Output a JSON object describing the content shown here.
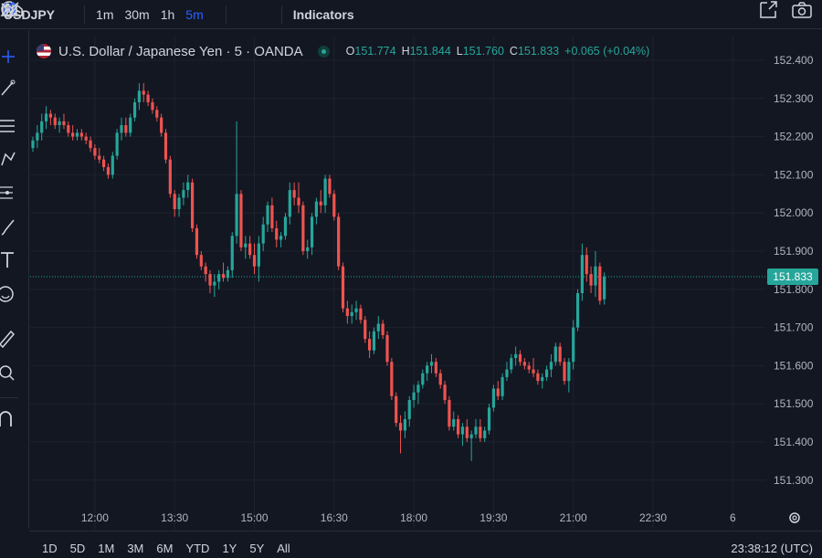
{
  "toolbar": {
    "symbol": "USDJPY",
    "intervals": [
      "1m",
      "30m",
      "1h",
      "5m"
    ],
    "active_interval": "5m",
    "indicators_label": "Indicators"
  },
  "legend": {
    "title": "U.S. Dollar / Japanese Yen · 5 · OANDA",
    "o_label": "O",
    "o": "151.774",
    "h_label": "H",
    "h": "151.844",
    "l_label": "L",
    "l": "151.760",
    "c_label": "C",
    "c": "151.833",
    "change": "+0.065 (+0.04%)"
  },
  "price_badge": "151.833",
  "ranges": [
    "1D",
    "5D",
    "1M",
    "3M",
    "6M",
    "YTD",
    "1Y",
    "5Y",
    "All"
  ],
  "clock": "23:38:12 (UTC)",
  "colors": {
    "up": "#26a69a",
    "down": "#ef5350",
    "background": "#131722",
    "grid": "#1e222d",
    "accent": "#2962ff"
  },
  "icons": [
    "plus-circle-icon",
    "bar-style-icon",
    "candles-icon",
    "area-icon",
    "chevron-down-icon",
    "indicators-icon",
    "crosshair-icon",
    "trendline-icon",
    "fib-icon",
    "pattern-icon",
    "prediction-icon",
    "brush-icon",
    "text-icon",
    "emoji-icon",
    "ruler-icon",
    "zoom-icon",
    "magnet-icon",
    "fullscreen-icon",
    "camera-icon",
    "settings-icon"
  ],
  "chart_data": {
    "type": "candlestick",
    "symbol": "USDJPY",
    "interval": "5m",
    "ylim": [
      151.25,
      152.45
    ],
    "y_ticks": [
      "152.400",
      "152.300",
      "152.200",
      "152.100",
      "152.000",
      "151.900",
      "151.800",
      "151.700",
      "151.600",
      "151.500",
      "151.400",
      "151.300"
    ],
    "x_ticks": [
      "12:00",
      "13:30",
      "15:00",
      "16:30",
      "18:00",
      "19:30",
      "21:00",
      "22:30",
      "6"
    ],
    "x_tick_index": [
      14,
      32,
      50,
      68,
      86,
      104,
      122,
      140,
      158
    ],
    "last_price": 151.833,
    "candles": [
      [
        152.17,
        152.2,
        152.16,
        152.19
      ],
      [
        152.19,
        152.23,
        152.17,
        152.21
      ],
      [
        152.21,
        152.26,
        152.19,
        152.24
      ],
      [
        152.24,
        152.28,
        152.22,
        152.26
      ],
      [
        152.26,
        152.27,
        152.23,
        152.25
      ],
      [
        152.25,
        152.26,
        152.22,
        152.23
      ],
      [
        152.23,
        152.25,
        152.21,
        152.24
      ],
      [
        152.24,
        152.26,
        152.22,
        152.23
      ],
      [
        152.23,
        152.24,
        152.2,
        152.21
      ],
      [
        152.21,
        152.23,
        152.19,
        152.2
      ],
      [
        152.2,
        152.22,
        152.19,
        152.21
      ],
      [
        152.21,
        152.22,
        152.19,
        152.2
      ],
      [
        152.2,
        152.21,
        152.18,
        152.19
      ],
      [
        152.19,
        152.2,
        152.16,
        152.17
      ],
      [
        152.17,
        152.18,
        152.14,
        152.15
      ],
      [
        152.15,
        152.17,
        152.13,
        152.14
      ],
      [
        152.14,
        152.15,
        152.11,
        152.12
      ],
      [
        152.12,
        152.13,
        152.09,
        152.1
      ],
      [
        152.1,
        152.16,
        152.09,
        152.15
      ],
      [
        152.15,
        152.22,
        152.14,
        152.21
      ],
      [
        152.21,
        152.25,
        152.19,
        152.23
      ],
      [
        152.23,
        152.25,
        152.2,
        152.21
      ],
      [
        152.21,
        152.26,
        152.2,
        152.25
      ],
      [
        152.25,
        152.3,
        152.24,
        152.29
      ],
      [
        152.29,
        152.34,
        152.27,
        152.32
      ],
      [
        152.32,
        152.34,
        152.29,
        152.31
      ],
      [
        152.31,
        152.32,
        152.28,
        152.29
      ],
      [
        152.29,
        152.3,
        152.26,
        152.27
      ],
      [
        152.27,
        152.28,
        152.24,
        152.25
      ],
      [
        152.25,
        152.26,
        152.2,
        152.21
      ],
      [
        152.21,
        152.22,
        152.13,
        152.14
      ],
      [
        152.14,
        152.15,
        152.04,
        152.05
      ],
      [
        152.05,
        152.06,
        151.99,
        152.01
      ],
      [
        152.01,
        152.05,
        151.99,
        152.04
      ],
      [
        152.04,
        152.08,
        152.02,
        152.06
      ],
      [
        152.06,
        152.1,
        152.04,
        152.08
      ],
      [
        152.08,
        152.09,
        151.95,
        151.96
      ],
      [
        151.96,
        151.97,
        151.88,
        151.89
      ],
      [
        151.89,
        151.9,
        151.85,
        151.86
      ],
      [
        151.86,
        151.87,
        151.82,
        151.84
      ],
      [
        151.84,
        151.85,
        151.79,
        151.81
      ],
      [
        151.81,
        151.84,
        151.78,
        151.82
      ],
      [
        151.82,
        151.85,
        151.8,
        151.84
      ],
      [
        151.84,
        151.87,
        151.82,
        151.83
      ],
      [
        151.83,
        151.86,
        151.82,
        151.85
      ],
      [
        151.85,
        151.95,
        151.83,
        151.94
      ],
      [
        151.94,
        152.24,
        151.92,
        152.05
      ],
      [
        152.05,
        152.06,
        151.9,
        151.91
      ],
      [
        151.91,
        151.94,
        151.88,
        151.92
      ],
      [
        151.92,
        151.94,
        151.88,
        151.89
      ],
      [
        151.89,
        151.92,
        151.84,
        151.86
      ],
      [
        151.86,
        151.94,
        151.82,
        151.92
      ],
      [
        151.92,
        151.99,
        151.9,
        151.97
      ],
      [
        151.97,
        152.03,
        151.95,
        152.02
      ],
      [
        152.02,
        152.04,
        151.95,
        151.96
      ],
      [
        151.96,
        151.98,
        151.91,
        151.93
      ],
      [
        151.93,
        151.95,
        151.91,
        151.94
      ],
      [
        151.94,
        152.0,
        151.93,
        151.99
      ],
      [
        151.99,
        152.08,
        151.97,
        152.06
      ],
      [
        152.06,
        152.08,
        152.02,
        152.04
      ],
      [
        152.04,
        152.08,
        152.0,
        152.02
      ],
      [
        152.02,
        152.03,
        151.89,
        151.9
      ],
      [
        151.9,
        151.93,
        151.88,
        151.91
      ],
      [
        151.91,
        152.0,
        151.89,
        151.99
      ],
      [
        151.99,
        152.04,
        151.97,
        152.03
      ],
      [
        152.03,
        152.06,
        152.0,
        152.02
      ],
      [
        152.02,
        152.1,
        152.0,
        152.09
      ],
      [
        152.09,
        152.1,
        152.04,
        152.05
      ],
      [
        152.05,
        152.06,
        151.98,
        151.99
      ],
      [
        151.99,
        152.0,
        151.85,
        151.86
      ],
      [
        151.86,
        151.87,
        151.74,
        151.75
      ],
      [
        151.75,
        151.77,
        151.71,
        151.73
      ],
      [
        151.73,
        151.76,
        151.71,
        151.74
      ],
      [
        151.74,
        151.77,
        151.72,
        151.75
      ],
      [
        151.75,
        151.76,
        151.71,
        151.72
      ],
      [
        151.72,
        151.73,
        151.66,
        151.67
      ],
      [
        151.67,
        151.69,
        151.62,
        151.64
      ],
      [
        151.64,
        151.7,
        151.63,
        151.69
      ],
      [
        151.69,
        151.73,
        151.67,
        151.71
      ],
      [
        151.71,
        151.72,
        151.67,
        151.68
      ],
      [
        151.68,
        151.69,
        151.6,
        151.61
      ],
      [
        151.61,
        151.62,
        151.51,
        151.52
      ],
      [
        151.52,
        151.53,
        151.44,
        151.45
      ],
      [
        151.45,
        151.47,
        151.37,
        151.43
      ],
      [
        151.43,
        151.48,
        151.41,
        151.46
      ],
      [
        151.46,
        151.52,
        151.44,
        151.51
      ],
      [
        151.51,
        151.55,
        151.49,
        151.53
      ],
      [
        151.53,
        151.56,
        151.5,
        151.55
      ],
      [
        151.55,
        151.59,
        151.54,
        151.58
      ],
      [
        151.58,
        151.61,
        151.56,
        151.6
      ],
      [
        151.6,
        151.63,
        151.58,
        151.61
      ],
      [
        151.61,
        151.62,
        151.57,
        151.58
      ],
      [
        151.58,
        151.59,
        151.54,
        151.55
      ],
      [
        151.55,
        151.56,
        151.5,
        151.51
      ],
      [
        151.51,
        151.52,
        151.43,
        151.44
      ],
      [
        151.44,
        151.48,
        151.43,
        151.46
      ],
      [
        151.46,
        151.47,
        151.41,
        151.42
      ],
      [
        151.42,
        151.45,
        151.39,
        151.44
      ],
      [
        151.44,
        151.46,
        151.4,
        151.41
      ],
      [
        151.41,
        151.43,
        151.35,
        151.42
      ],
      [
        151.42,
        151.46,
        151.41,
        151.44
      ],
      [
        151.44,
        151.46,
        151.4,
        151.41
      ],
      [
        151.41,
        151.44,
        151.4,
        151.43
      ],
      [
        151.43,
        151.5,
        151.42,
        151.49
      ],
      [
        151.49,
        151.55,
        151.48,
        151.54
      ],
      [
        151.54,
        151.56,
        151.51,
        151.52
      ],
      [
        151.52,
        151.58,
        151.51,
        151.57
      ],
      [
        151.57,
        151.61,
        151.56,
        151.59
      ],
      [
        151.59,
        151.63,
        151.58,
        151.62
      ],
      [
        151.62,
        151.65,
        151.6,
        151.63
      ],
      [
        151.63,
        151.64,
        151.6,
        151.61
      ],
      [
        151.61,
        151.62,
        151.59,
        151.6
      ],
      [
        151.6,
        151.61,
        151.58,
        151.59
      ],
      [
        151.59,
        151.62,
        151.57,
        151.58
      ],
      [
        151.58,
        151.59,
        151.55,
        151.56
      ],
      [
        151.56,
        151.58,
        151.54,
        151.57
      ],
      [
        151.57,
        151.6,
        151.56,
        151.59
      ],
      [
        151.59,
        151.63,
        151.57,
        151.61
      ],
      [
        151.61,
        151.66,
        151.6,
        151.65
      ],
      [
        151.65,
        151.66,
        151.6,
        151.61
      ],
      [
        151.61,
        151.62,
        151.55,
        151.56
      ],
      [
        151.56,
        151.62,
        151.53,
        151.61
      ],
      [
        151.61,
        151.72,
        151.59,
        151.7
      ],
      [
        151.7,
        151.8,
        151.69,
        151.79
      ],
      [
        151.79,
        151.92,
        151.77,
        151.89
      ],
      [
        151.89,
        151.91,
        151.82,
        151.84
      ],
      [
        151.84,
        151.86,
        151.79,
        151.81
      ],
      [
        151.81,
        151.9,
        151.78,
        151.86
      ],
      [
        151.86,
        151.87,
        151.76,
        151.77
      ],
      [
        151.774,
        151.844,
        151.76,
        151.833
      ]
    ]
  }
}
